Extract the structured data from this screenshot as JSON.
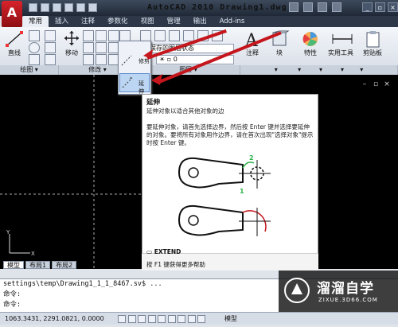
{
  "app": {
    "title": "AutoCAD 2010  Drawing1.dwg",
    "logo_letter": "A"
  },
  "tabs": [
    "常用",
    "插入",
    "注释",
    "参数化",
    "视图",
    "管理",
    "输出",
    "Add-ins"
  ],
  "ribbon": {
    "draw": {
      "label": "绘图",
      "line": "直线"
    },
    "modify": {
      "label": "修改",
      "move": "移动"
    },
    "layers": {
      "label": "图层",
      "layer_state": "未保存的图层状态",
      "current_layer": "0"
    },
    "annotation": "注释",
    "block": "块",
    "properties": "特性",
    "utilities": "实用工具",
    "clipboard": "剪贴板"
  },
  "dropdown": {
    "trim": "修剪",
    "extend": "延伸"
  },
  "tooltip": {
    "title": "延伸",
    "subtitle": "延伸对象以适合其他对象的边",
    "description": "要延伸对象，请首先选择边界，然后按 Enter 键并选择要延伸的对象。要将所有对象用作边界，请在首次出现\"选择对象\"提示时按 Enter 键。",
    "label_2": "2",
    "label_1": "1",
    "command": "EXTEND",
    "help": "按 F1 键获得更多帮助"
  },
  "layout_tabs": [
    "模型",
    "布局1",
    "布局2"
  ],
  "command_line": [
    "settings\\temp\\Drawing1_1_1_8467.sv$ ...",
    "命令:",
    "命令:"
  ],
  "status": {
    "coords": "1063.3431, 2291.0821, 0.0000",
    "model": "模型"
  },
  "watermark": {
    "brand": "溜溜自学",
    "url": "ZIXUE.3D66.COM"
  },
  "colors": {
    "accent_red": "#c4161c",
    "titlebar": "#2d3747",
    "canvas": "#000000"
  }
}
